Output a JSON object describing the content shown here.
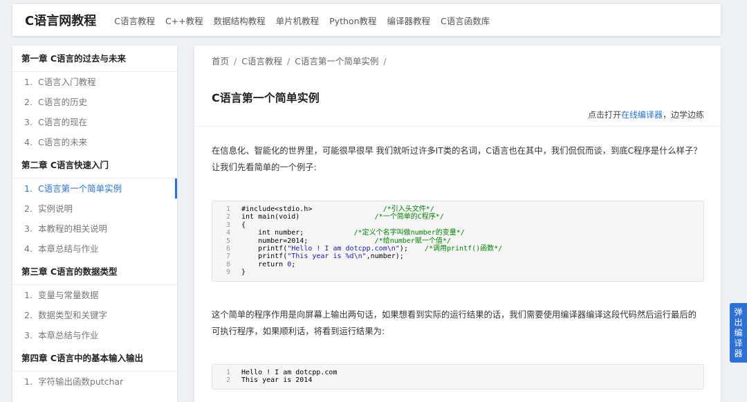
{
  "header": {
    "logo": "C语言网教程",
    "nav": [
      "C语言教程",
      "C++教程",
      "数据结构教程",
      "单片机教程",
      "Python教程",
      "编译器教程",
      "C语言函数库"
    ]
  },
  "sidebar": {
    "chapters": [
      {
        "title": "第一章 C语言的过去与未来",
        "items": [
          {
            "num": "1.",
            "label": "C语言入门教程"
          },
          {
            "num": "2.",
            "label": "C语言的历史"
          },
          {
            "num": "3.",
            "label": "C语言的现在"
          },
          {
            "num": "4.",
            "label": "C语言的未来"
          }
        ]
      },
      {
        "title": "第二章 C语言快速入门",
        "items": [
          {
            "num": "1.",
            "label": "C语言第一个简单实例",
            "active": true
          },
          {
            "num": "2.",
            "label": "实例说明"
          },
          {
            "num": "3.",
            "label": "本教程的相关说明"
          },
          {
            "num": "4.",
            "label": "本章总结与作业"
          }
        ]
      },
      {
        "title": "第三章 C语言的数据类型",
        "items": [
          {
            "num": "1.",
            "label": "变量与常量数据"
          },
          {
            "num": "2.",
            "label": "数据类型和关键字"
          },
          {
            "num": "3.",
            "label": "本章总结与作业"
          }
        ]
      },
      {
        "title": "第四章 C语言中的基本输入输出",
        "items": [
          {
            "num": "1.",
            "label": "字符输出函数putchar"
          }
        ]
      }
    ]
  },
  "main": {
    "breadcrumb": [
      "首页",
      "C语言教程",
      "C语言第一个简单实例"
    ],
    "breadcrumb_sep": "/",
    "title": "C语言第一个简单实例",
    "editor_note": {
      "prefix": "点击打开",
      "link": "在线编译器",
      "suffix": "，边学边练"
    },
    "para1": "在信息化、智能化的世界里，可能很早很早 我们就听过许多IT类的名词，C语言也在其中，我们侃侃而谈，到底C程序是什么样子？让我们先看简单的一个例子:",
    "code1": [
      {
        "n": "1",
        "parts": [
          {
            "t": "#include<stdio.h>                 "
          },
          {
            "t": "/*引入头文件*/",
            "c": "com"
          }
        ]
      },
      {
        "n": "2",
        "parts": [
          {
            "t": "int main(void)                  "
          },
          {
            "t": "/*一个简单的C程序*/",
            "c": "com"
          }
        ]
      },
      {
        "n": "3",
        "parts": [
          {
            "t": "{"
          }
        ]
      },
      {
        "n": "4",
        "parts": [
          {
            "t": "    int number;            "
          },
          {
            "t": "/*定义个名字叫做number的变量*/",
            "c": "com"
          }
        ]
      },
      {
        "n": "5",
        "parts": [
          {
            "t": "    number=2014;                "
          },
          {
            "t": "/*给number赋一个值*/",
            "c": "com"
          }
        ]
      },
      {
        "n": "6",
        "parts": [
          {
            "t": "    printf("
          },
          {
            "t": "\"Hello ! I am dotcpp.com\\n\"",
            "c": "str"
          },
          {
            "t": ");    "
          },
          {
            "t": "/*调用printf()函数*/",
            "c": "com"
          }
        ]
      },
      {
        "n": "7",
        "parts": [
          {
            "t": "    printf("
          },
          {
            "t": "\"This year is %d\\n\"",
            "c": "str"
          },
          {
            "t": ",number);"
          }
        ]
      },
      {
        "n": "8",
        "parts": [
          {
            "t": "    return "
          },
          {
            "t": "0",
            "c": "str"
          },
          {
            "t": ";"
          }
        ]
      },
      {
        "n": "9",
        "parts": [
          {
            "t": "}"
          }
        ]
      }
    ],
    "para2": "这个简单的程序作用是向屏幕上输出两句话，如果想看到实际的运行结果的话，我们需要使用编译器编译这段代码然后运行最后的可执行程序，如果顺利话，将看到运行结果为:",
    "code2": [
      {
        "n": "1",
        "parts": [
          {
            "t": "Hello ! I am dotcpp.com"
          }
        ]
      },
      {
        "n": "2",
        "parts": [
          {
            "t": "This year is 2014"
          }
        ]
      }
    ]
  },
  "float_button": [
    "弹",
    "出",
    "编",
    "译",
    "器"
  ]
}
